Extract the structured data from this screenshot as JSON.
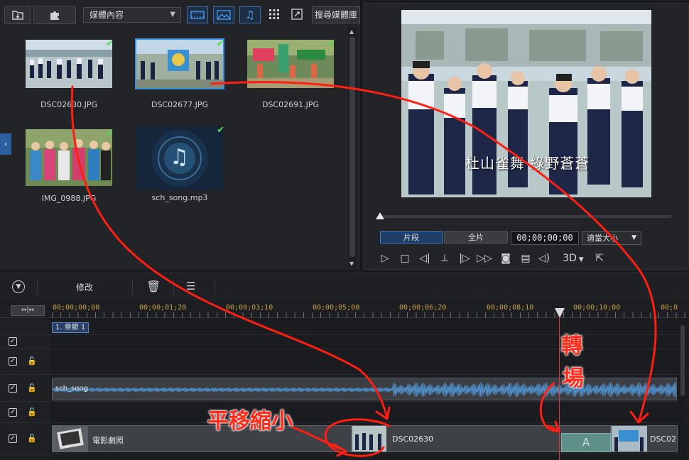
{
  "library": {
    "media_filter": "媒體內容",
    "search_button": "搜尋媒體庫",
    "items": [
      {
        "name": "DSC02630.JPG",
        "checked": true,
        "selected": false,
        "kind": "photo-crowd"
      },
      {
        "name": "DSC02677.JPG",
        "checked": true,
        "selected": true,
        "kind": "photo-stage"
      },
      {
        "name": "DSC02691.JPG",
        "checked": true,
        "selected": false,
        "kind": "photo-festival"
      },
      {
        "name": "IMG_0988.JPG",
        "checked": true,
        "selected": false,
        "kind": "photo-group"
      },
      {
        "name": "sch_song.mp3",
        "checked": true,
        "selected": false,
        "kind": "audio"
      }
    ]
  },
  "preview": {
    "caption": "杜山雀舞 綠野蒼蒼",
    "clip_tab": "片段",
    "full_tab": "全片",
    "timecode": "00;00;00;00",
    "fit_option": "適當大小",
    "mode_3d": "3D"
  },
  "timeline_toolbar": {
    "modify_label": "修改"
  },
  "ruler": {
    "fit_label": "↔|↔",
    "ticks": [
      "00;00;00;00",
      "00;00;01;20",
      "00;00;03;10",
      "00;00;05;00",
      "00;00;06;20",
      "00;00;08;10",
      "00;00;10;00",
      "00;0"
    ]
  },
  "tracks": {
    "chapter": "1. 章節 1",
    "audio_clip": "sch_song",
    "video_clips": [
      {
        "label": "電影劇照"
      },
      {
        "label": "DSC02630"
      },
      {
        "label": "DSC02"
      }
    ],
    "transition_glyph": "A"
  },
  "annotations": {
    "transition_note_1": "轉",
    "transition_note_2": "場",
    "pan_zoom_note": "平移縮小"
  },
  "colors": {
    "accent": "#3b8fe0",
    "annotation": "#ff2a1a",
    "ruler_text": "#c9a24a",
    "check": "#4be04b"
  }
}
